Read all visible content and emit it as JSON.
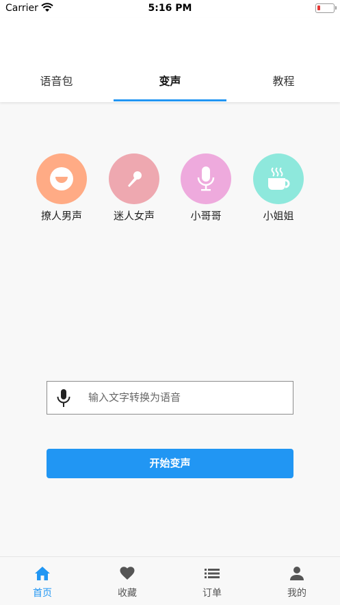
{
  "status_bar": {
    "carrier": "Carrier",
    "time": "5:16 PM"
  },
  "tabs": [
    {
      "label": "语音包",
      "active": false
    },
    {
      "label": "变声",
      "active": true
    },
    {
      "label": "教程",
      "active": false
    }
  ],
  "voice_options": [
    {
      "label": "撩人男声",
      "icon": "smile-face-icon",
      "color": "#ffab85"
    },
    {
      "label": "迷人女声",
      "icon": "karaoke-mic-icon",
      "color": "#eea8b0"
    },
    {
      "label": "小哥哥",
      "icon": "microphone-icon",
      "color": "#eeaadd"
    },
    {
      "label": "小姐姐",
      "icon": "coffee-cup-icon",
      "color": "#8ee8dc"
    }
  ],
  "text_input": {
    "placeholder": "输入文字转换为语音",
    "value": ""
  },
  "start_button": {
    "label": "开始变声"
  },
  "tabbar": [
    {
      "label": "首页",
      "icon": "home-icon",
      "active": true
    },
    {
      "label": "收藏",
      "icon": "heart-icon",
      "active": false
    },
    {
      "label": "订单",
      "icon": "list-icon",
      "active": false
    },
    {
      "label": "我的",
      "icon": "person-icon",
      "active": false
    }
  ],
  "colors": {
    "accent": "#2196f3",
    "background": "#f8f8f8"
  }
}
